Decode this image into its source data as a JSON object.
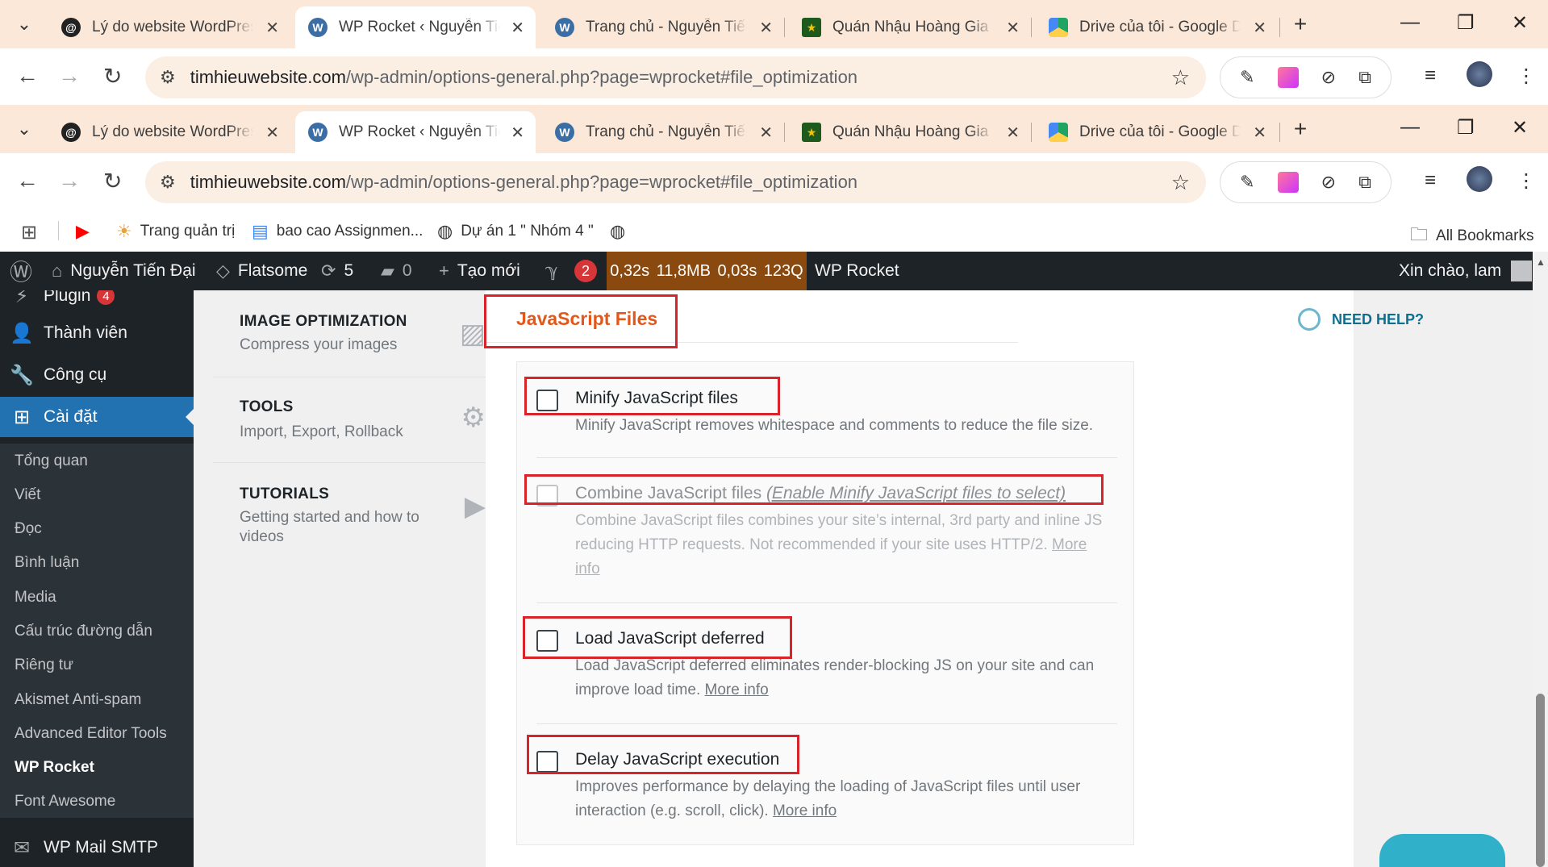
{
  "browser": {
    "tabs": [
      {
        "title": "Lý do website WordPress",
        "icon": "threads-icon"
      },
      {
        "title": "WP Rocket ‹ Nguyễn Tiến",
        "icon": "wordpress-icon",
        "active": true
      },
      {
        "title": "Trang chủ - Nguyễn Tiến",
        "icon": "wordpress-icon"
      },
      {
        "title": "Quán Nhậu Hoàng Gia",
        "icon": "star-favicon"
      },
      {
        "title": "Drive của tôi - Google Dr",
        "icon": "google-drive-icon"
      }
    ],
    "url_host": "timhieuwebsite.com",
    "url_path": "/wp-admin/options-general.php?page=wprocket#file_optimization",
    "bookmarks": [
      {
        "label": "",
        "icon": "youtube-icon"
      },
      {
        "label": "Trang quản trị",
        "icon": "bookmark-icon"
      },
      {
        "label": "bao cao Assignmen...",
        "icon": "docs-icon"
      },
      {
        "label": "Dự án 1 \" Nhóm 4 \"",
        "icon": "globe-icon"
      },
      {
        "label": "",
        "icon": "globe-icon"
      }
    ],
    "all_bookmarks": "All Bookmarks"
  },
  "adminbar": {
    "site_name": "Nguyễn Tiến Đại",
    "theme": "Flatsome",
    "updates": "5",
    "comments": "0",
    "new": "Tạo mới",
    "yoast_count": "2",
    "stats": [
      "0,32s",
      "11,8MB",
      "0,03s",
      "123Q"
    ],
    "wp_rocket": "WP Rocket",
    "greeting": "Xin chào, lam"
  },
  "sidebar": {
    "top": [
      {
        "label": "Plugin",
        "badge": "4"
      },
      {
        "label": "Thành viên"
      },
      {
        "label": "Công cụ"
      },
      {
        "label": "Cài đặt",
        "current": true
      }
    ],
    "sub": [
      "Tổng quan",
      "Viết",
      "Đọc",
      "Bình luận",
      "Media",
      "Cấu trúc đường dẫn",
      "Riêng tư",
      "Akismet Anti-spam",
      "Advanced Editor Tools",
      "WP Rocket",
      "Font Awesome"
    ],
    "bottom": "WP Mail SMTP"
  },
  "rocket_nav": [
    {
      "title": "IMAGE OPTIMIZATION",
      "desc": "Compress your images"
    },
    {
      "title": "TOOLS",
      "desc": "Import, Export, Rollback"
    },
    {
      "title": "TUTORIALS",
      "desc": "Getting started and how to videos"
    }
  ],
  "panel": {
    "title": "JavaScript Files",
    "need_help": "NEED HELP?",
    "options": [
      {
        "label": "Minify JavaScript files",
        "desc": "Minify JavaScript removes whitespace and comments to reduce the file size.",
        "checked": false
      },
      {
        "label": "Combine JavaScript files",
        "label_note": "(Enable Minify JavaScript files to select)",
        "desc": "Combine JavaScript files combines your site’s internal, 3rd party and inline JS reducing HTTP requests. Not recommended if your site uses HTTP/2.",
        "more": "More info",
        "disabled": true,
        "checked": false
      },
      {
        "label": "Load JavaScript deferred",
        "desc": "Load JavaScript deferred eliminates render-blocking JS on your site and can improve load time.",
        "more": "More info",
        "checked": false
      },
      {
        "label": "Delay JavaScript execution",
        "desc": "Improves performance by delaying the loading of JavaScript files until user interaction (e.g. scroll, click).",
        "more": "More info",
        "checked": false
      }
    ]
  },
  "colors": {
    "accent": "#2271b1",
    "rocket_orange": "#e2571a",
    "highlight_red": "#d8232a"
  }
}
